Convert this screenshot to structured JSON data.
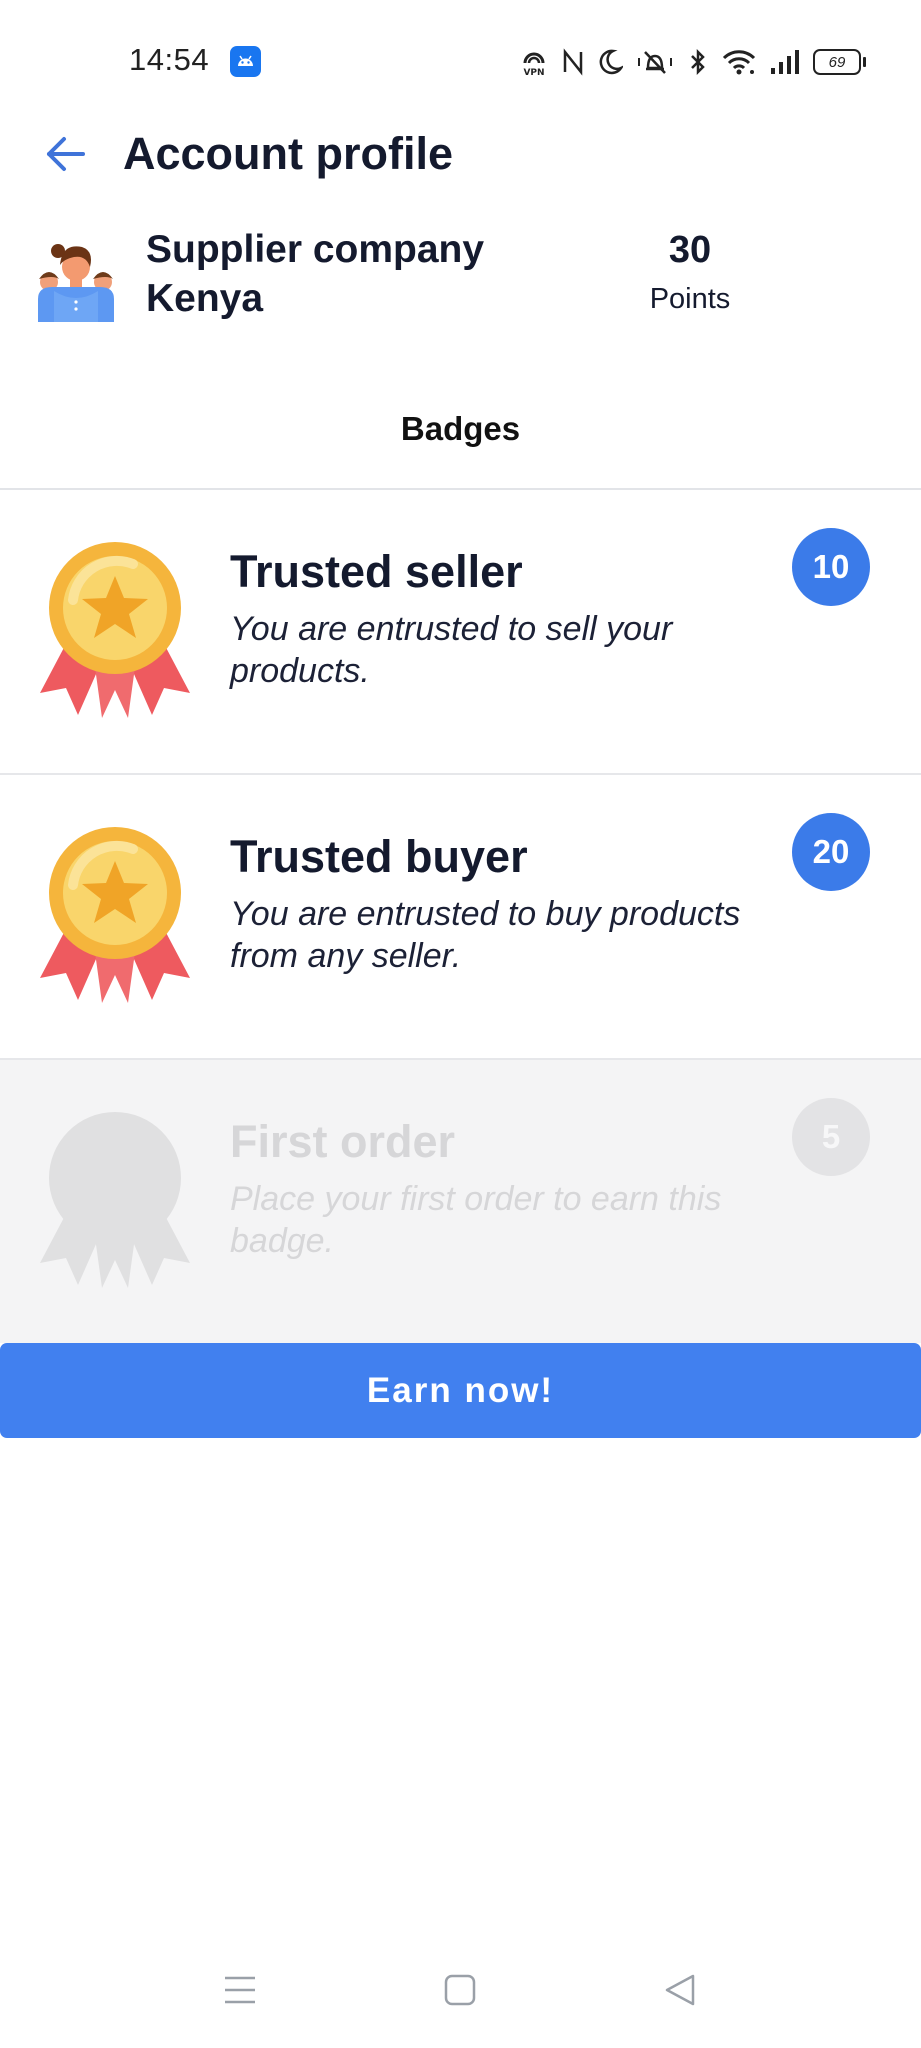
{
  "status_bar": {
    "time": "14:54",
    "battery_level": "69",
    "icons": [
      "android-app-icon",
      "vpn-icon",
      "nfc-icon",
      "do-not-disturb-icon",
      "vibrate-icon",
      "bluetooth-icon",
      "wifi-icon",
      "cellular-signal-icon",
      "battery-icon"
    ]
  },
  "header": {
    "title": "Account profile",
    "back_icon": "arrow-left-icon"
  },
  "profile": {
    "company_name": "Supplier company Kenya",
    "points_value": "30",
    "points_label": "Points"
  },
  "badges": {
    "heading": "Badges",
    "items": [
      {
        "title": "Trusted seller",
        "description": "You are entrusted to sell your products.",
        "points": "10",
        "earned": true
      },
      {
        "title": "Trusted buyer",
        "description": "You are entrusted to buy products from any seller.",
        "points": "20",
        "earned": true
      },
      {
        "title": "First order",
        "description": "Place your first order to earn this badge.",
        "points": "5",
        "earned": false
      }
    ]
  },
  "actions": {
    "earn_now_label": "Earn now!"
  },
  "colors": {
    "accent": "#4180ef",
    "badge_circle": "#3b7be9",
    "medal_gold": "#f7c145",
    "ribbon_red": "#ef5a5e",
    "locked_gray": "#e0e0e0"
  },
  "nav_bar": {
    "icons": [
      "menu-icon",
      "home-square-icon",
      "back-triangle-icon"
    ]
  }
}
